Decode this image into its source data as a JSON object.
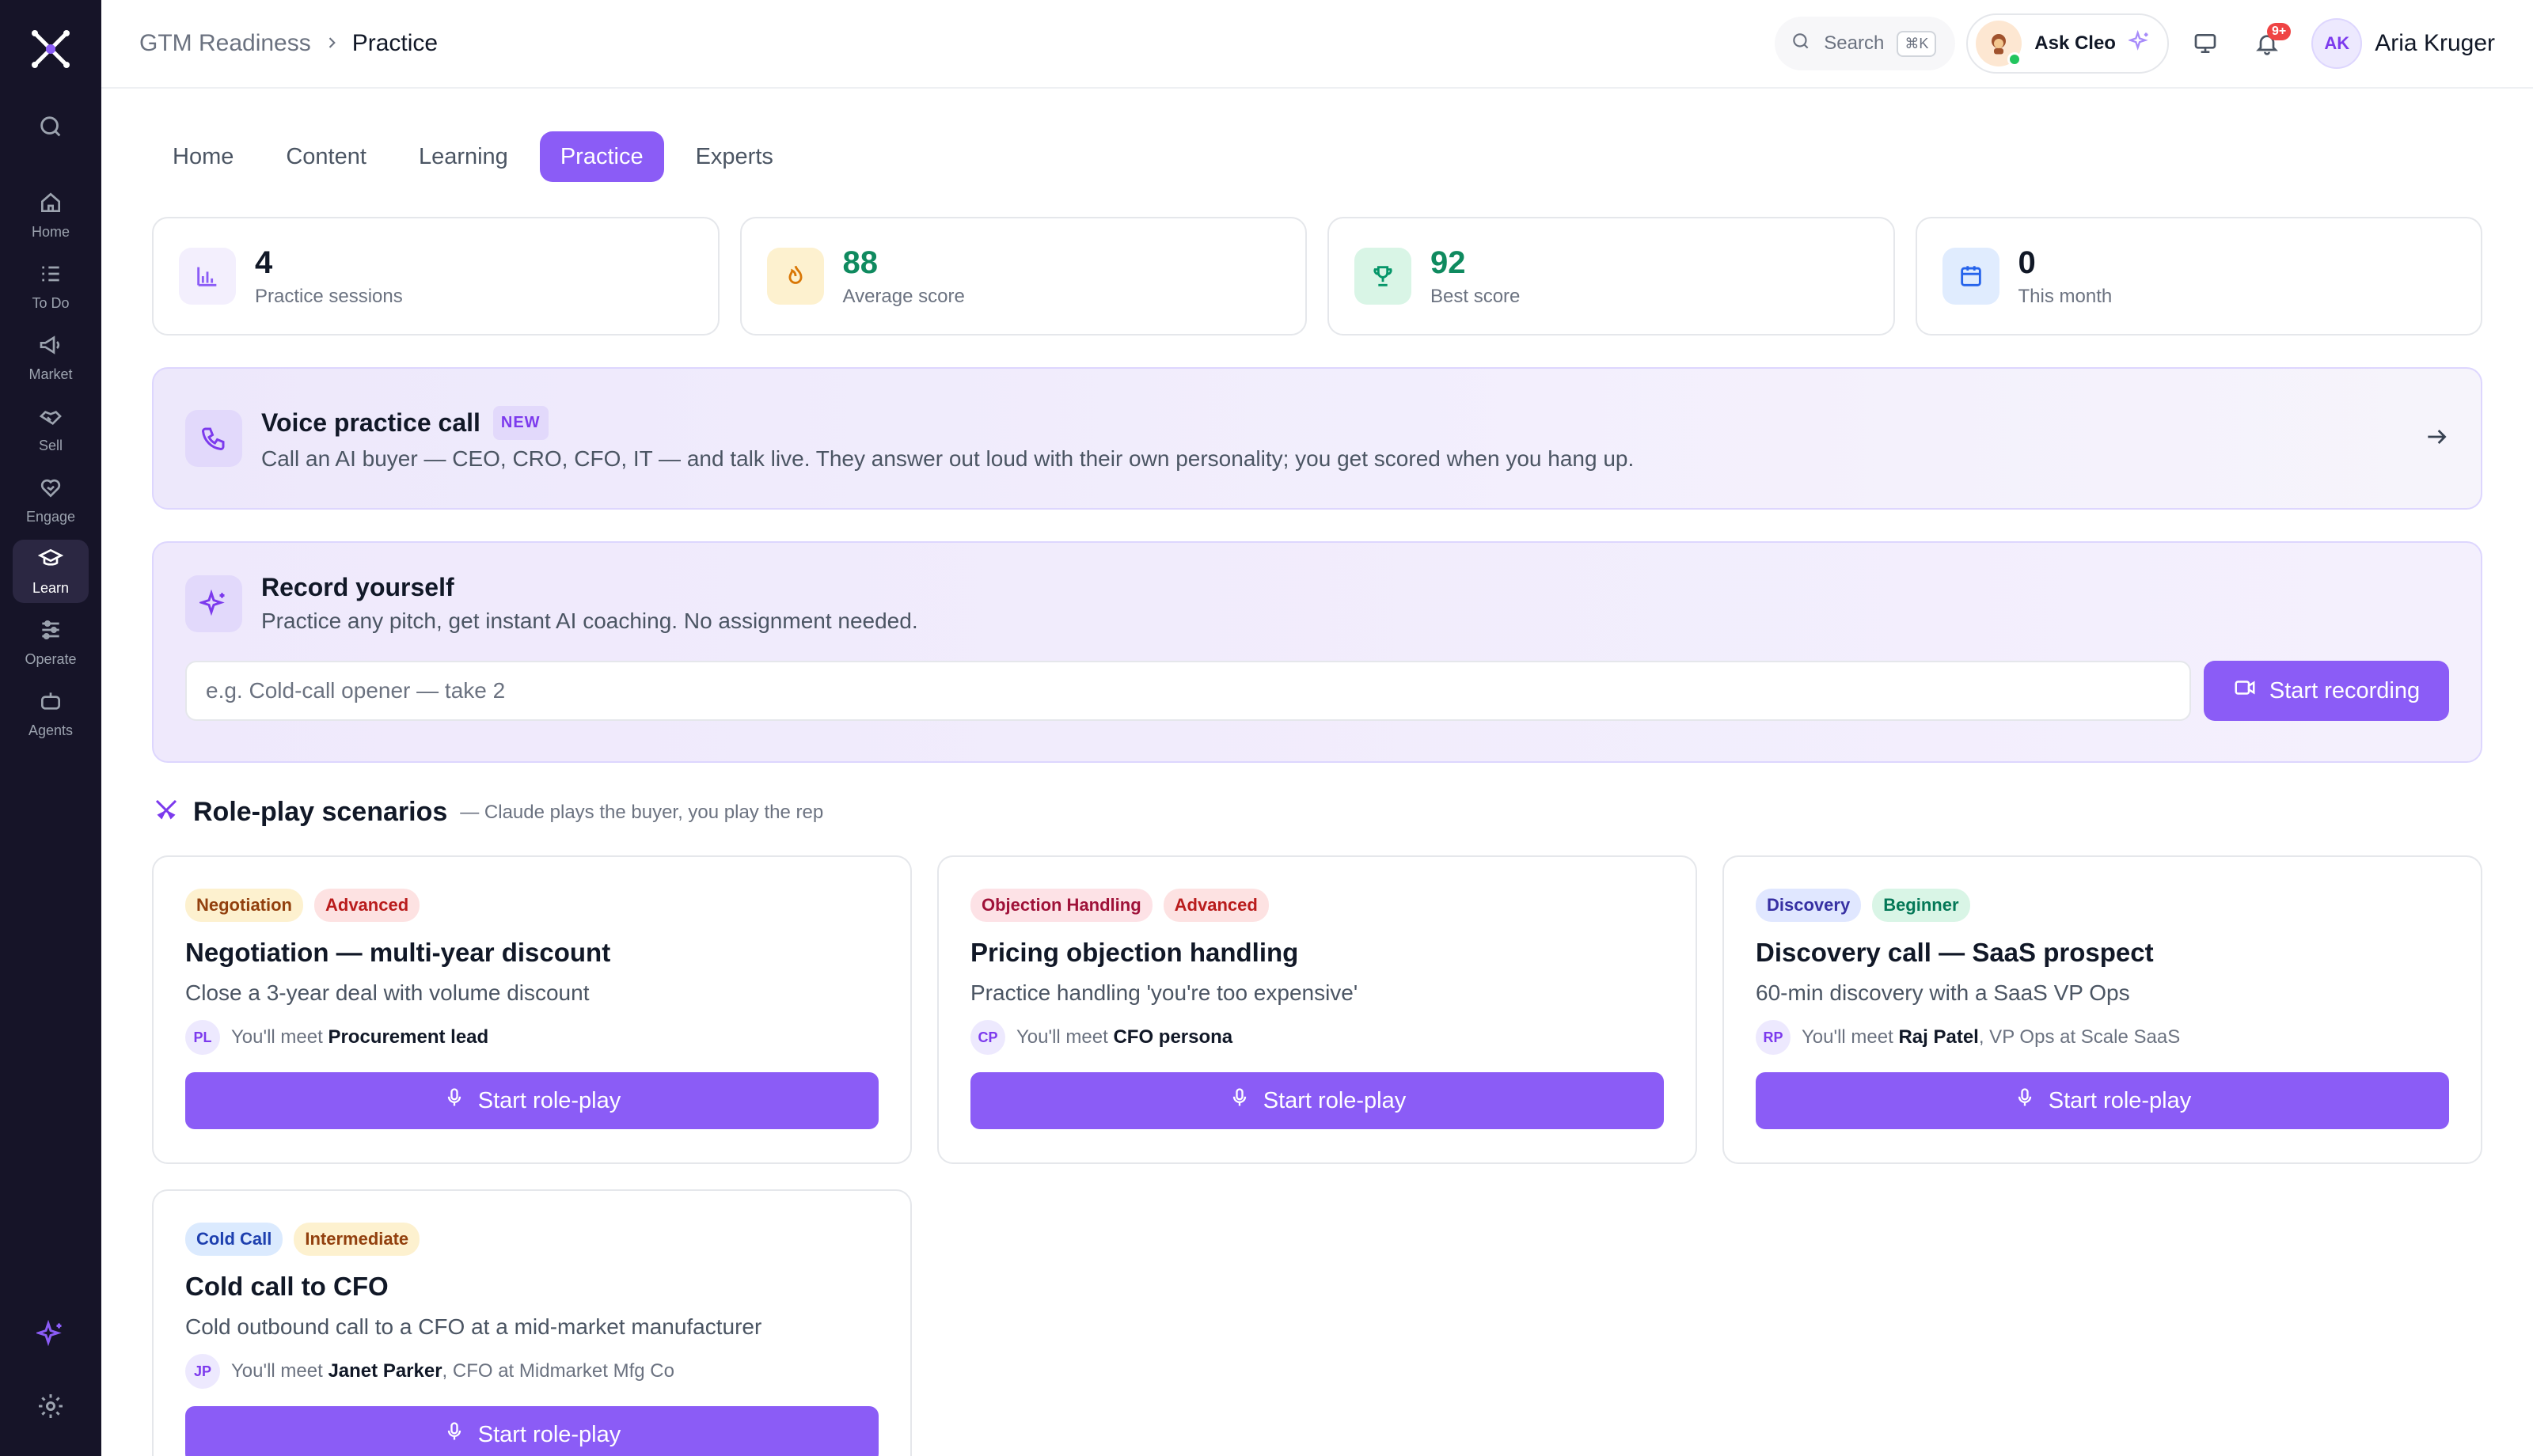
{
  "breadcrumb": {
    "parent": "GTM Readiness",
    "current": "Practice"
  },
  "topbar": {
    "search_label": "Search",
    "search_shortcut": "⌘K",
    "ask_label": "Ask Cleo",
    "notifications_badge": "9+",
    "user_initials": "AK",
    "user_name": "Aria Kruger"
  },
  "sidebar": {
    "items": [
      {
        "label": "Home",
        "icon": "home-icon"
      },
      {
        "label": "To Do",
        "icon": "checklist-icon"
      },
      {
        "label": "Market",
        "icon": "megaphone-icon"
      },
      {
        "label": "Sell",
        "icon": "handshake-icon"
      },
      {
        "label": "Engage",
        "icon": "heart-handshake-icon"
      },
      {
        "label": "Learn",
        "icon": "graduation-cap-icon"
      },
      {
        "label": "Operate",
        "icon": "sliders-icon"
      },
      {
        "label": "Agents",
        "icon": "bot-icon"
      }
    ],
    "active": "Learn"
  },
  "tabs": [
    "Home",
    "Content",
    "Learning",
    "Practice",
    "Experts"
  ],
  "active_tab": "Practice",
  "stats": [
    {
      "value": "4",
      "label": "Practice sessions",
      "icon": "bar-chart-icon",
      "bg": "#f3effd",
      "fg": "#8b5cf6",
      "value_color": "#111827"
    },
    {
      "value": "88",
      "label": "Average score",
      "icon": "flame-icon",
      "bg": "#fdf1cf",
      "fg": "#d97706",
      "value_color": "#0f8a5f"
    },
    {
      "value": "92",
      "label": "Best score",
      "icon": "trophy-icon",
      "bg": "#d9f5e6",
      "fg": "#059669",
      "value_color": "#0f8a5f"
    },
    {
      "value": "0",
      "label": "This month",
      "icon": "calendar-icon",
      "bg": "#e0ecfe",
      "fg": "#2563eb",
      "value_color": "#111827"
    }
  ],
  "voice": {
    "title": "Voice practice call",
    "badge": "NEW",
    "description": "Call an AI buyer — CEO, CRO, CFO, IT — and talk live. They answer out loud with their own personality; you get scored when you hang up."
  },
  "record": {
    "title": "Record yourself",
    "description": "Practice any pitch, get instant AI coaching. No assignment needed.",
    "placeholder": "e.g. Cold-call opener — take 2",
    "button": "Start recording"
  },
  "scenarios": {
    "title": "Role-play scenarios",
    "subtitle": "— Claude plays the buyer, you play the rep",
    "meet_prefix": "You'll meet",
    "button": "Start role-play",
    "cards": [
      {
        "tags": [
          {
            "text": "Negotiation",
            "bg": "#fdf1cf",
            "fg": "#92400e"
          },
          {
            "text": "Advanced",
            "bg": "#fde2e2",
            "fg": "#b91c1c"
          }
        ],
        "title": "Negotiation — multi-year discount",
        "description": "Close a 3-year deal with volume discount",
        "initials": "PL",
        "person": "Procurement lead",
        "person_extra": ""
      },
      {
        "tags": [
          {
            "text": "Objection Handling",
            "bg": "#fde2e6",
            "fg": "#9f1239"
          },
          {
            "text": "Advanced",
            "bg": "#fde2e2",
            "fg": "#b91c1c"
          }
        ],
        "title": "Pricing objection handling",
        "description": "Practice handling 'you're too expensive'",
        "initials": "CP",
        "person": "CFO persona",
        "person_extra": ""
      },
      {
        "tags": [
          {
            "text": "Discovery",
            "bg": "#e0e7ff",
            "fg": "#3730a3"
          },
          {
            "text": "Beginner",
            "bg": "#d9f5e6",
            "fg": "#047857"
          }
        ],
        "title": "Discovery call — SaaS prospect",
        "description": "60-min discovery with a SaaS VP Ops",
        "initials": "RP",
        "person": "Raj Patel",
        "person_extra": ", VP Ops at Scale SaaS"
      },
      {
        "tags": [
          {
            "text": "Cold Call",
            "bg": "#dbeafe",
            "fg": "#1e40af"
          },
          {
            "text": "Intermediate",
            "bg": "#fdf1cf",
            "fg": "#92400e"
          }
        ],
        "title": "Cold call to CFO",
        "description": "Cold outbound call to a CFO at a mid-market manufacturer",
        "initials": "JP",
        "person": "Janet Parker",
        "person_extra": ", CFO at Midmarket Mfg Co"
      }
    ]
  }
}
